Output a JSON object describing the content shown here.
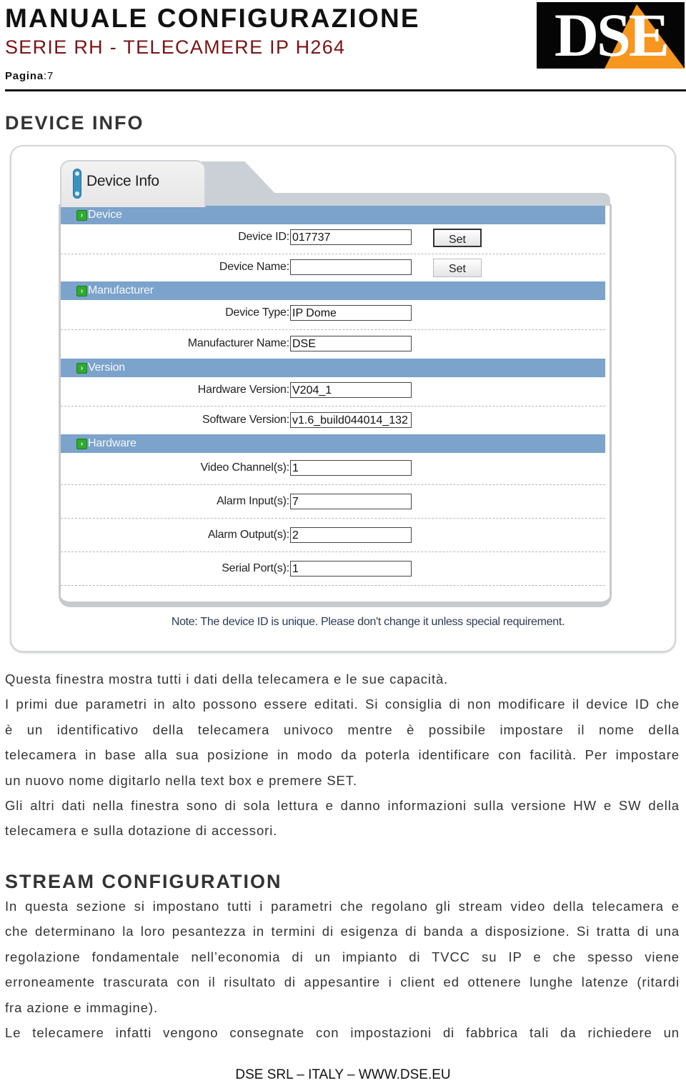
{
  "header": {
    "title": "MANUALE CONFIGURAZIONE",
    "subtitle": "SERIE RH -  TELECAMERE IP H264",
    "page_label": "Pagina",
    "page_number": ":7",
    "logo_text": "DSE",
    "colors": {
      "subtitle": "#7a1414",
      "logo_bg": "#050505",
      "logo_accent": "#f6961e"
    }
  },
  "sections": {
    "device_info_heading": "DEVICE INFO",
    "stream_config_heading": "STREAM CONFIGURATION"
  },
  "screenshot": {
    "tab_label": "Device Info",
    "groups": [
      {
        "label": "Device"
      },
      {
        "label": "Manufacturer"
      },
      {
        "label": "Version"
      },
      {
        "label": "Hardware"
      }
    ],
    "fields": {
      "device_id": {
        "label": "Device ID:",
        "value": "017737"
      },
      "device_name": {
        "label": "Device Name:",
        "value": ""
      },
      "device_type": {
        "label": "Device Type:",
        "value": "IP Dome"
      },
      "manufacturer": {
        "label": "Manufacturer Name:",
        "value": "DSE"
      },
      "hw_version": {
        "label": "Hardware Version:",
        "value": "V204_1"
      },
      "sw_version": {
        "label": "Software Version:",
        "value": "v1.6_build044014_132"
      },
      "video_channels": {
        "label": "Video Channel(s):",
        "value": "1"
      },
      "alarm_inputs": {
        "label": "Alarm Input(s):",
        "value": "7"
      },
      "alarm_outputs": {
        "label": "Alarm Output(s):",
        "value": "2"
      },
      "serial_ports": {
        "label": "Serial Port(s):",
        "value": "1"
      }
    },
    "set_button_label": "Set",
    "note": "Note: The device ID is unique. Please don't change it unless special requirement.",
    "colors": {
      "section_bar": "#7ba3cb",
      "section_icon": "#2faa2f",
      "tab_pill": "#3b92bd"
    }
  },
  "body": {
    "device_info_lines": [
      "Questa finestra mostra tutti i dati della telecamera e le sue capacità.",
      "I primi due parametri in alto possono essere editati. Si consiglia di non modificare il device ID che",
      "è un identificativo della telecamera univoco mentre è possibile impostare il nome della",
      "telecamera in base alla sua posizione in modo da poterla identificare con facilità. Per impostare",
      "un nuovo nome digitarlo nella text box e premere SET.",
      "Gli altri dati nella finestra sono di sola lettura e danno informazioni sulla versione HW e SW della",
      "telecamera e sulla dotazione di accessori."
    ],
    "stream_config_lines": [
      "In questa sezione si impostano tutti i parametri che regolano gli stream video della telecamera e",
      "che determinano la loro pesantezza in termini di esigenza di banda a disposizione. Si tratta di una",
      "regolazione fondamentale nell’economia di un impianto di TVCC su IP e che spesso viene",
      "erroneamente trascurata con il risultato di appesantire i client ed ottenere lunghe latenze (ritardi",
      "fra azione e immagine).",
      "Le telecamere infatti vengono consegnate con impostazioni di fabbrica tali da richiedere un"
    ]
  },
  "footer": {
    "text": "DSE SRL – ITALY – WWW.DSE.EU"
  }
}
